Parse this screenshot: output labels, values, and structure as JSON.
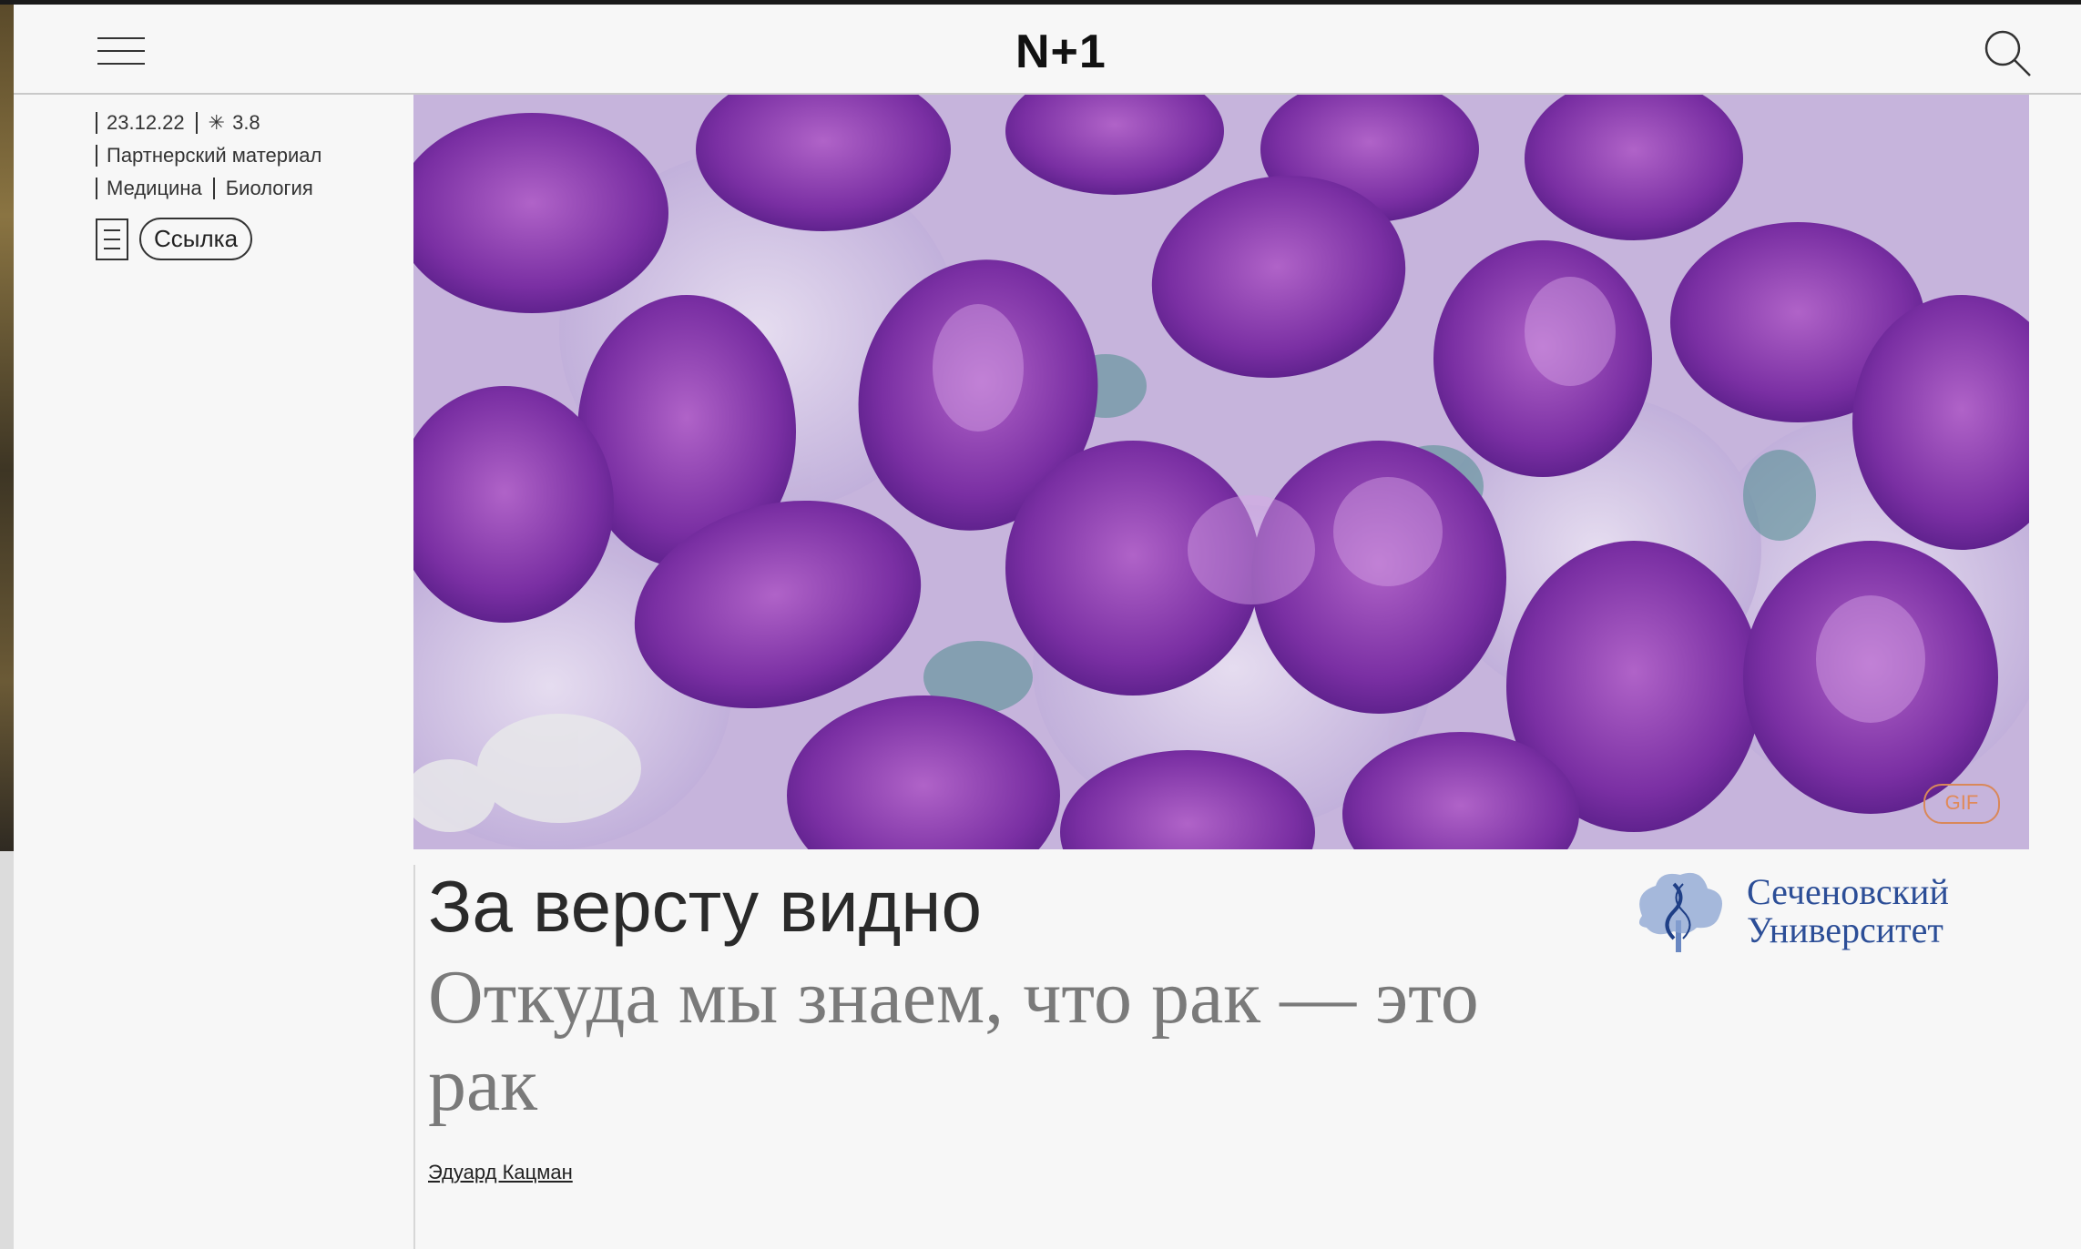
{
  "header": {
    "logo": "N+1"
  },
  "meta": {
    "date": "23.12.22",
    "difficulty": "3.8",
    "label": "Партнерский материал",
    "categories": [
      "Медицина",
      "Биология"
    ],
    "link_button": "Ссылка"
  },
  "hero": {
    "badge": "GIF"
  },
  "article": {
    "title": "За версту видно",
    "subtitle": "Откуда мы знаем, что рак — это рак",
    "author": "Эдуард Кацман"
  },
  "partner": {
    "line1": "Сеченовский",
    "line2": "Университет"
  },
  "colors": {
    "accent_partner": "#2c4e97",
    "gif_badge": "#d9885a",
    "cell_purple": "#6b2a94"
  }
}
